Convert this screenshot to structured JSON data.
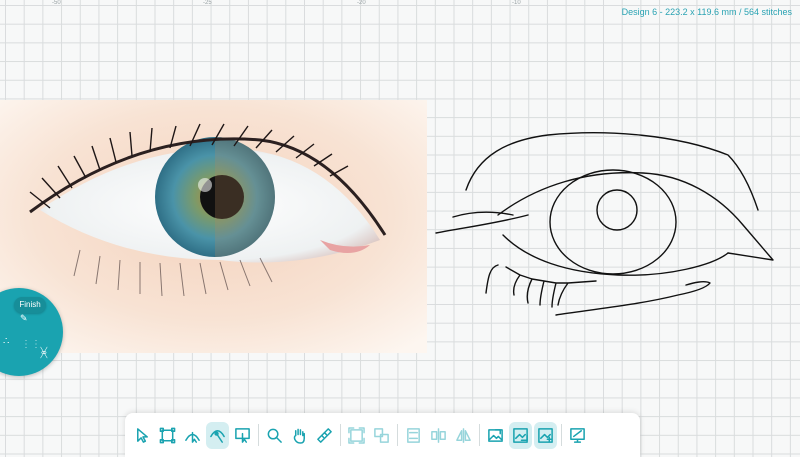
{
  "ruler": {
    "labels": [
      "-50",
      "-25",
      "-20",
      "-10"
    ]
  },
  "design": {
    "info": "Design 6 - 223.2 x 119.6 mm / 564 stitches"
  },
  "circle_menu": {
    "finish_label": "Finish",
    "icons": [
      "pencil-icon",
      "share-icon",
      "grid-icon",
      "lasso-icon"
    ]
  },
  "toolbar": {
    "buttons": [
      "select-arrow-icon",
      "bounding-box-icon",
      "node-select-icon",
      "node-edit-icon",
      "image-crop-icon",
      "zoom-icon",
      "pan-hand-icon",
      "ruler-icon",
      "fit-frame-icon",
      "align-icon",
      "stack-icon",
      "distribute-icon",
      "mirror-icon",
      "image-icon",
      "trace-image-icon",
      "trace-image-alt-icon",
      "preview-icon"
    ],
    "active": [
      "node-edit-icon",
      "trace-image-icon",
      "trace-image-alt-icon"
    ]
  },
  "colors": {
    "accent": "#1aa3b0",
    "grid": "#d9dcdd",
    "background": "#f7f8f8"
  }
}
